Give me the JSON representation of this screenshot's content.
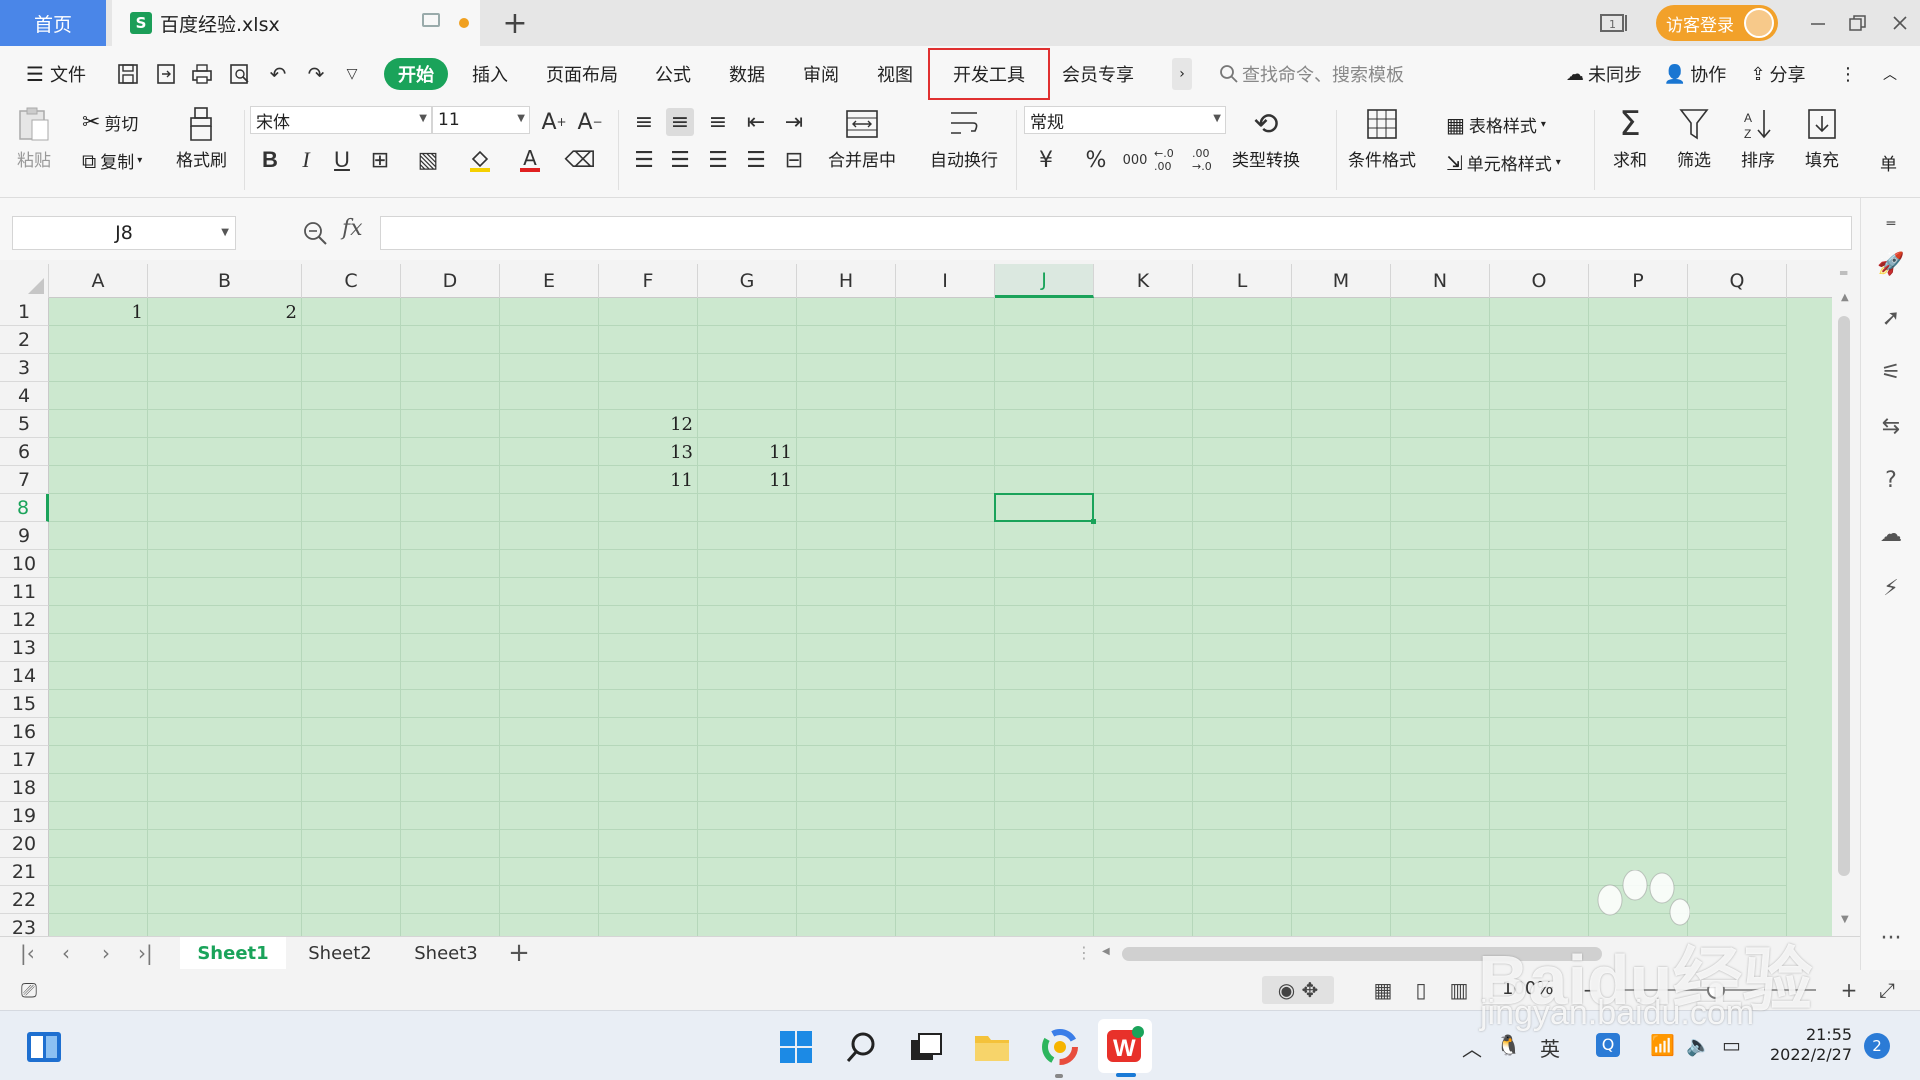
{
  "tabs": {
    "home": "首页",
    "file_icon": "S",
    "file_name": "百度经验.xlsx",
    "new_tab": "+"
  },
  "titlebar": {
    "login_label": "访客登录"
  },
  "menu": {
    "file": "文件",
    "items": [
      "开始",
      "插入",
      "页面布局",
      "公式",
      "数据",
      "审阅",
      "视图",
      "开发工具",
      "会员专享"
    ],
    "search_placeholder": "查找命令、搜索模板",
    "sync": "未同步",
    "collab": "协作",
    "share": "分享"
  },
  "ribbon": {
    "paste": "粘贴",
    "cut": "剪切",
    "copy": "复制",
    "format_painter": "格式刷",
    "font_name": "宋体",
    "font_size": "11",
    "bold": "B",
    "italic": "I",
    "underline": "U",
    "font_color_letter": "A",
    "merge_center": "合并居中",
    "wrap_text": "自动换行",
    "number_format": "常规",
    "currency": "¥",
    "percent": "%",
    "thousands": "000",
    "inc_decimal": "←.0 .00",
    "dec_decimal": ".00 →.0",
    "type_convert": "类型转换",
    "conditional_format": "条件格式",
    "table_style": "表格样式",
    "cell_style": "单元格样式",
    "sum": "求和",
    "filter": "筛选",
    "sort": "排序",
    "fill": "填充",
    "single": "单"
  },
  "formula_bar": {
    "name_box": "J8",
    "fx": "fx",
    "formula": ""
  },
  "columns": [
    "A",
    "B",
    "C",
    "D",
    "E",
    "F",
    "G",
    "H",
    "I",
    "J",
    "K",
    "L",
    "M",
    "N",
    "O",
    "P",
    "Q"
  ],
  "selected_column": "J",
  "rows": [
    "1",
    "2",
    "3",
    "4",
    "5",
    "6",
    "7",
    "8",
    "9",
    "10",
    "11",
    "12",
    "13",
    "14",
    "15",
    "16",
    "17",
    "18",
    "19",
    "20",
    "21",
    "22",
    "23"
  ],
  "selected_row": "8",
  "cells": [
    {
      "ref": "A1",
      "value": "1"
    },
    {
      "ref": "B1",
      "value": "2"
    },
    {
      "ref": "F5",
      "value": "12"
    },
    {
      "ref": "F6",
      "value": "13"
    },
    {
      "ref": "G6",
      "value": "11"
    },
    {
      "ref": "F7",
      "value": "11"
    },
    {
      "ref": "G7",
      "value": "11"
    }
  ],
  "sheets": {
    "tabs": [
      "Sheet1",
      "Sheet2",
      "Sheet3"
    ],
    "active": "Sheet1",
    "add": "+"
  },
  "statusbar": {
    "zoom": "100%",
    "zoom_level": 0.5
  },
  "taskbar": {
    "time": "21:55",
    "date": "2022/2/27",
    "ime": "英",
    "notifications": "2"
  },
  "watermark": {
    "logo": "Baidu经验",
    "url": "jingyan.baidu.com"
  },
  "colors": {
    "accent": "#1aa35a",
    "grid_bg": "#cce8cf",
    "home_tab": "#4a86e8",
    "login": "#f2a12a",
    "highlight_box": "#e03030"
  }
}
